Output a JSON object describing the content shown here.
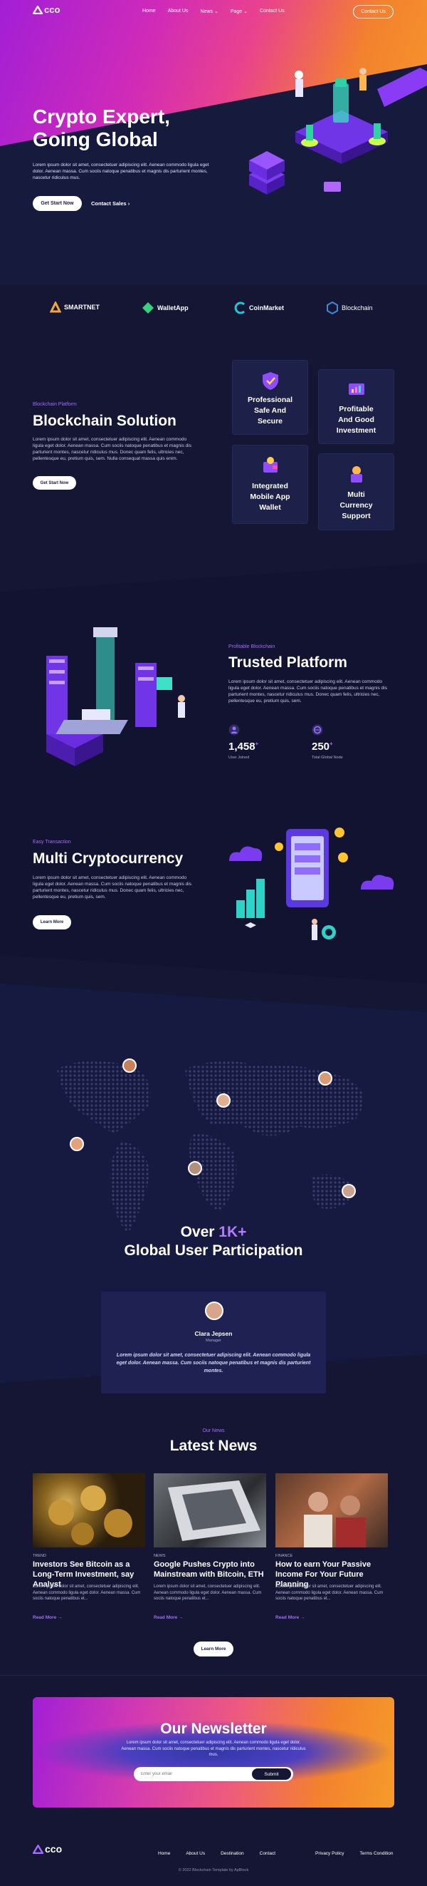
{
  "brand": {
    "name": "cco"
  },
  "nav": {
    "items": [
      "Home",
      "About Us",
      "News",
      "Page",
      "Contact Us"
    ],
    "contact_button": "Contact Us"
  },
  "hero": {
    "title_line1": "Crypto Expert,",
    "title_line2": "Going Global",
    "text": "Lorem ipsum dolor sit amet, consectetuer adipiscing elit. Aenean commodo ligula eget dolor. Aenean massa. Cum sociis natoque penatibus et magnis dis parturient montes, nascetur ridiculus mus.",
    "cta_primary": "Get Start Now",
    "cta_secondary": "Contact Sales"
  },
  "partners": [
    {
      "name": "SMARTNET",
      "icon": "smartnet-logo-icon",
      "color": "#f3a63a"
    },
    {
      "name": "WalletApp",
      "icon": "walletapp-logo-icon",
      "color": "#3ad07a"
    },
    {
      "name": "CoinMarket",
      "icon": "coinmarket-logo-icon",
      "color": "#29c3d6"
    },
    {
      "name": "Blockchain",
      "icon": "blockchain-logo-icon",
      "color": "#3a8bd6"
    }
  ],
  "blockchain": {
    "eyebrow": "Blockchain Platform",
    "title": "Blockchain Solution",
    "text": "Lorem ipsum dolor sit amet, consectetuer adipiscing elit. Aenean commodo ligula eget dolor. Aenean massa. Cum sociis natoque penatibus et magnis dis parturient montes, nascetur ridiculus mus. Donec quam felis, ultricies nec, pellentesque eu, pretium quis, sem. Nulla consequat massa quis enim.",
    "button": "Get Start Now",
    "features": [
      {
        "label": "Professional\nSafe And\nSecure",
        "icon": "shield-icon"
      },
      {
        "label": "Profitable\nAnd Good\nInvestment",
        "icon": "investment-icon"
      },
      {
        "label": "Integrated\nMobile App\nWallet",
        "icon": "wallet-icon"
      },
      {
        "label": "Multi\nCurrency\nSupport",
        "icon": "currency-icon"
      }
    ]
  },
  "trusted": {
    "eyebrow": "Profitable Blockchain",
    "title": "Trusted Platform",
    "text": "Lorem ipsum dolor sit amet, consectetuer adipiscing elit. Aenean commodo ligula eget dolor. Aenean massa. Cum sociis natoque penatibus et magnis dis parturient montes, nascetur ridiculus mus. Donec quam felis, ultricies nec, pellentesque eu, pretium quis, sem.",
    "stats": [
      {
        "value": "1,458",
        "suffix": "+",
        "label": "User Joined",
        "icon": "users-icon"
      },
      {
        "value": "250",
        "suffix": "+",
        "label": "Total Global Node",
        "icon": "globe-icon"
      }
    ]
  },
  "multi": {
    "eyebrow": "Easy Transaction",
    "title": "Multi Cryptocurrency",
    "text": "Lorem ipsum dolor sit amet, consectetuer adipiscing elit. Aenean commodo ligula eget dolor. Aenean massa. Cum sociis natoque penatibus et magnis dis parturient montes, nascetur ridiculus mus. Donec quam felis, ultricies nec, pellentesque eu, pretium quis, sem.",
    "button": "Learn More"
  },
  "global": {
    "title_prefix": "Over",
    "title_highlight": "1K+",
    "title_line2": "Global User Participation"
  },
  "testimonial": {
    "name": "Clara Jepsen",
    "role": "Manager",
    "quote": "Lorem ipsum dolor sit amet, consectetuer adipiscing elit. Aenean commodo ligula eget dolor. Aenean massa. Cum sociis natoque penatibus et magnis dis parturient montes."
  },
  "news": {
    "eyebrow": "Our News",
    "title": "Latest News",
    "items": [
      {
        "category": "TREND",
        "title": "Investors See Bitcoin as a Long-Term Investment, say Analyst",
        "text": "Lorem ipsum dolor sit amet, consectetuer adipiscing elit. Aenean commodo ligula eget dolor. Aenean massa. Cum sociis natoque penatibus et...",
        "read": "Read More"
      },
      {
        "category": "NEWS",
        "title": "Google Pushes Crypto into Mainstream with Bitcoin, ETH",
        "text": "Lorem ipsum dolor sit amet, consectetuer adipiscing elit. Aenean commodo ligula eget dolor. Aenean massa. Cum sociis natoque penatibus et...",
        "read": "Read More"
      },
      {
        "category": "FINANCE",
        "title": "How to earn Your Passive Income For Your Future Planning",
        "text": "Lorem ipsum dolor sit amet, consectetuer adipiscing elit. Aenean commodo ligula eget dolor. Aenean massa. Cum sociis natoque penatibus et...",
        "read": "Read More"
      }
    ],
    "button": "Learn More"
  },
  "newsletter": {
    "title": "Our Newsletter",
    "text": "Lorem ipsum dolor sit amet, consectetuer adipiscing elit. Aenean commodo ligula eget dolor. Aenean massa. Cum sociis natoque penatibus et magnis dis parturient montes, nascetur ridiculus mus.",
    "placeholder": "Enter your email",
    "button": "Submit"
  },
  "footer": {
    "links": [
      "Home",
      "About Us",
      "Destination",
      "Contact"
    ],
    "legal": [
      "Privacy Policy",
      "Terms Condition"
    ],
    "copyright": "© 2022 Blockchain Template by ApBlock"
  },
  "colors": {
    "accent": "#a46bff",
    "background": "#141634",
    "card": "#1d2048"
  }
}
